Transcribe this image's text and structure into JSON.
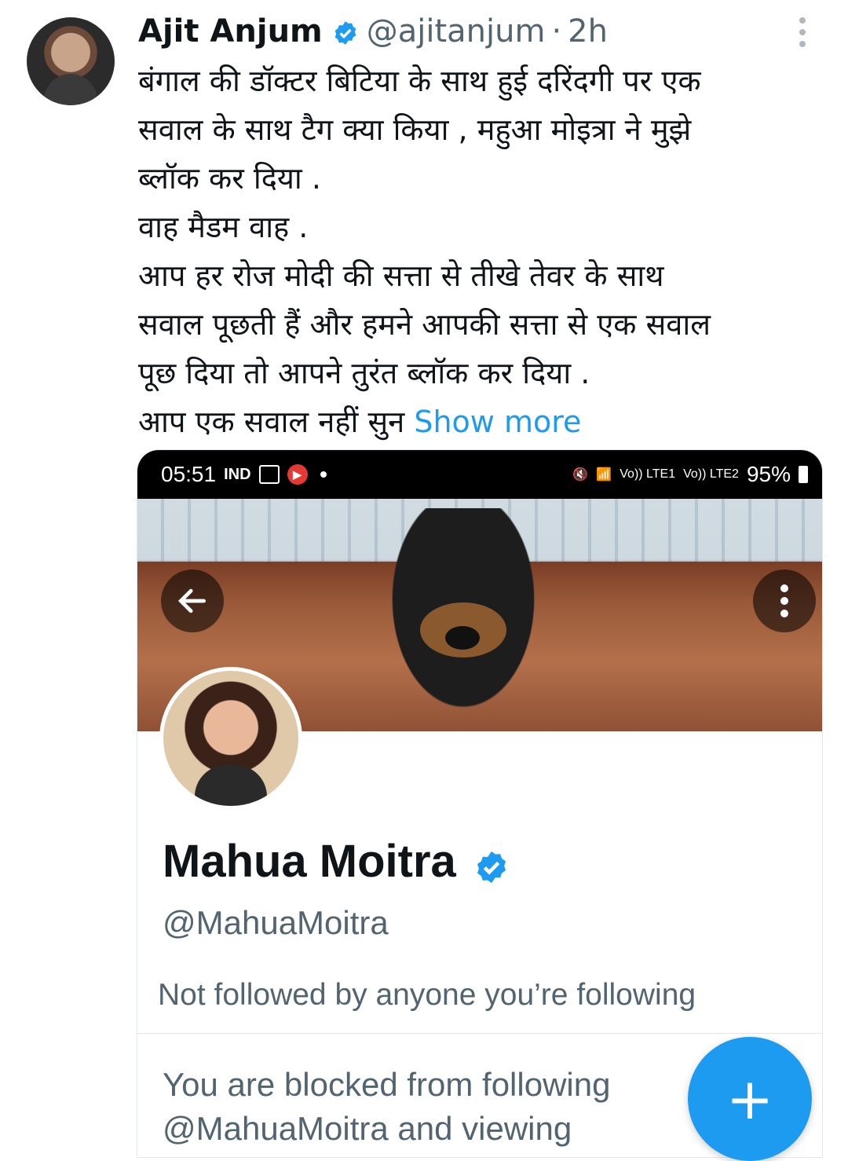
{
  "tweet": {
    "author_name": "Ajit Anjum",
    "handle": "@ajitanjum",
    "separator": "·",
    "time": "2h",
    "lines": [
      "बंगाल की डॉक्टर बिटिया के साथ हुई दरिंदगी पर एक",
      "सवाल के साथ टैग क्या किया , महुआ मोइत्रा ने मुझे",
      "ब्लॉक कर दिया .",
      "वाह मैडम वाह .",
      "आप हर रोज मोदी की सत्ता से तीखे तेवर के साथ",
      "सवाल पूछती हैं और हमने आपकी सत्ता से एक सवाल",
      "पूछ दिया तो आपने तुरंत ब्लॉक कर दिया .",
      "आप एक सवाल नहीं सुन "
    ],
    "show_more": "Show more"
  },
  "screenshot": {
    "status_bar": {
      "time": "05:51",
      "carrier": "IND",
      "battery": "95%",
      "sim1": "Vo)) LTE1",
      "sim2": "Vo)) LTE2"
    },
    "profile": {
      "name": "Mahua Moitra",
      "handle": "@MahuaMoitra",
      "following_note": "Not followed by anyone you’re following",
      "blocked_lines": [
        "You are blocked from following",
        "@MahuaMoitra and viewing"
      ]
    }
  },
  "fab": {
    "label": "+"
  },
  "colors": {
    "accent": "#1d9bf0",
    "secondary_text": "#536471"
  },
  "icons": [
    "verified-badge-icon",
    "more-vertical-icon",
    "back-arrow-icon",
    "wifi-icon",
    "mute-icon",
    "battery-icon",
    "plus-icon"
  ]
}
